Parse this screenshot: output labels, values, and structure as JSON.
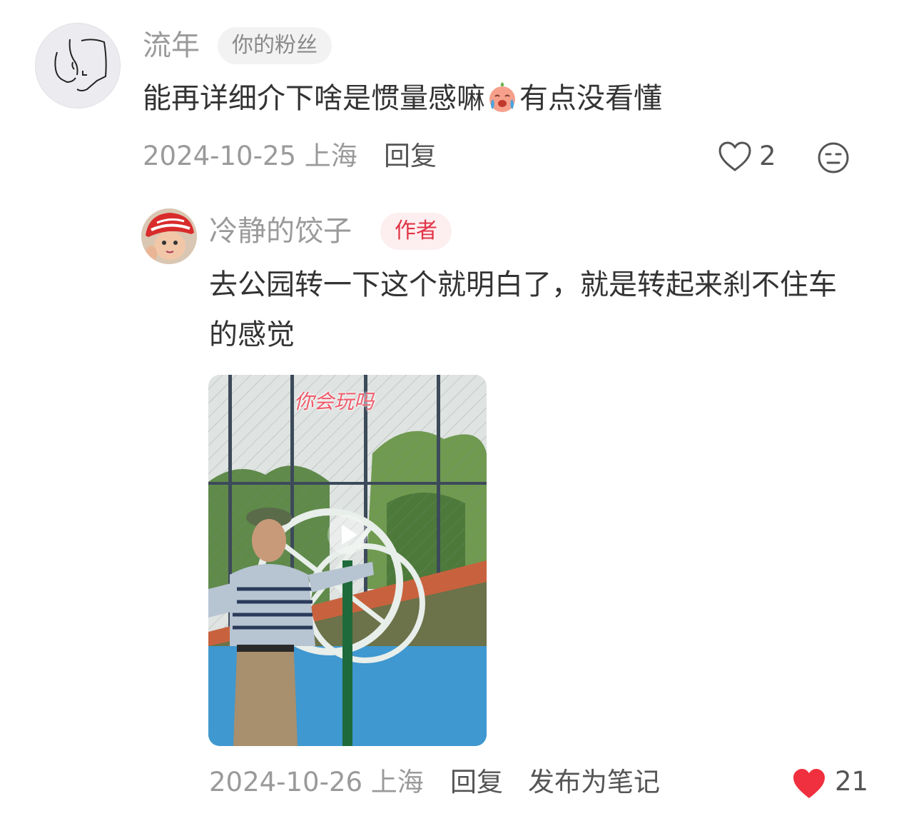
{
  "comment": {
    "username": "流年",
    "badge": "你的粉丝",
    "text_before_emoji": "能再详细介下啥是惯量感嘛",
    "emoji": "crying-face-emoji",
    "text_after_emoji": "有点没看懂",
    "date_location": "2024-10-25 上海",
    "reply_label": "回复",
    "like_count": "2"
  },
  "reply": {
    "username": "冷静的饺子",
    "badge": "作者",
    "text": "去公园转一下这个就明白了，就是转起来刹不住车的感觉",
    "media": {
      "overlay_caption": "你会玩吗",
      "type": "video"
    },
    "date_location": "2024-10-26 上海",
    "reply_label": "回复",
    "publish_label": "发布为笔记",
    "like_count": "21",
    "like_color": "#f0303e"
  },
  "icons": {
    "like": "heart-outline-icon",
    "emoji_react": "neutral-face-icon",
    "liked": "heart-filled-icon",
    "play": "play-icon"
  }
}
